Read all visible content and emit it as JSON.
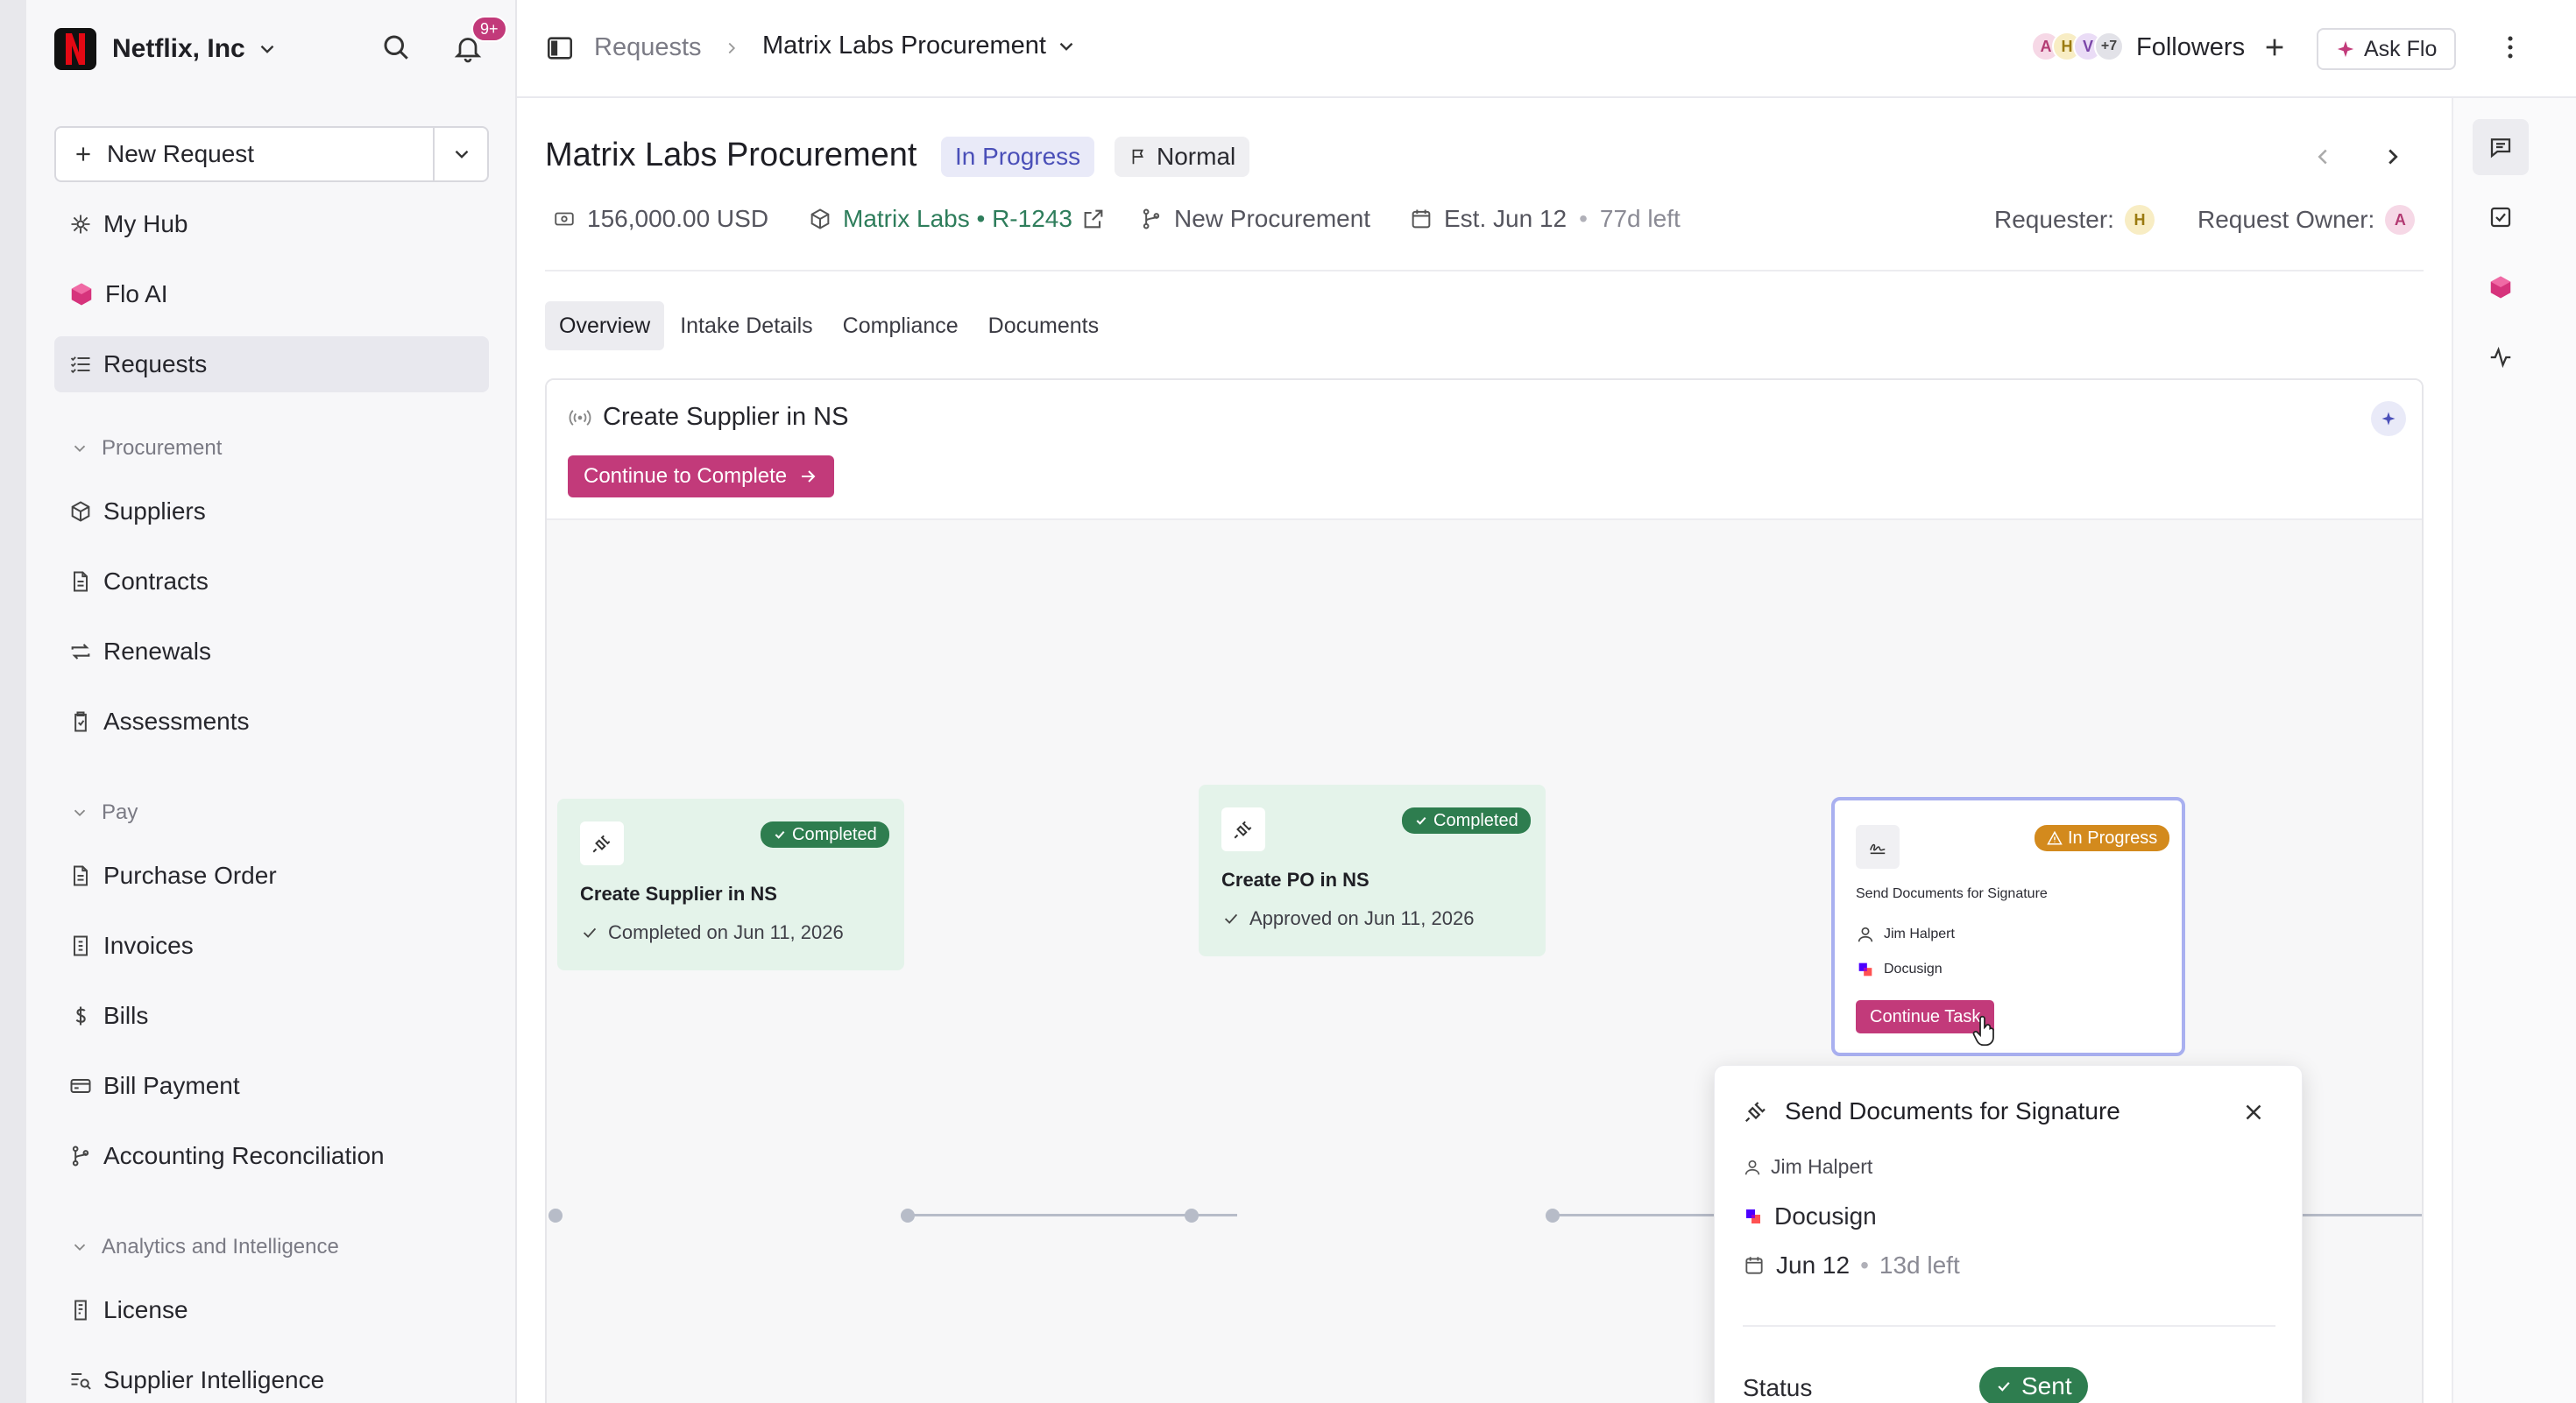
{
  "org": {
    "name": "Netflix, Inc",
    "notification_badge": "9+"
  },
  "sidebar": {
    "new_request": "New Request",
    "items": [
      {
        "label": "My Hub"
      },
      {
        "label": "Flo AI"
      },
      {
        "label": "Requests"
      }
    ],
    "procurement": {
      "label": "Procurement",
      "items": [
        {
          "label": "Suppliers"
        },
        {
          "label": "Contracts"
        },
        {
          "label": "Renewals"
        },
        {
          "label": "Assessments"
        }
      ]
    },
    "pay": {
      "label": "Pay",
      "items": [
        {
          "label": "Purchase Order"
        },
        {
          "label": "Invoices"
        },
        {
          "label": "Bills"
        },
        {
          "label": "Bill Payment"
        },
        {
          "label": "Accounting Reconciliation"
        }
      ]
    },
    "analytics": {
      "label": "Analytics and Intelligence",
      "items": [
        {
          "label": "License"
        },
        {
          "label": "Supplier Intelligence"
        }
      ]
    }
  },
  "topbar": {
    "breadcrumb_root": "Requests",
    "breadcrumb_current": "Matrix Labs Procurement",
    "avatars": [
      "A",
      "H",
      "V",
      "+7"
    ],
    "followers": "Followers",
    "ask_flo": "Ask Flo"
  },
  "request": {
    "title": "Matrix Labs Procurement",
    "status": "In Progress",
    "priority": "Normal",
    "amount": "156,000.00 USD",
    "supplier_link": "Matrix Labs • R-1243",
    "workflow": "New Procurement",
    "estimate": "Est. Jun 12",
    "time_left": "77d left",
    "requester_label": "Requester:",
    "requester_initial": "H",
    "owner_label": "Request Owner:",
    "owner_initial": "A"
  },
  "tabs": [
    {
      "label": "Overview"
    },
    {
      "label": "Intake Details"
    },
    {
      "label": "Compliance"
    },
    {
      "label": "Documents"
    }
  ],
  "panel": {
    "title": "Create Supplier in NS",
    "continue_button": "Continue to Complete"
  },
  "nodes": [
    {
      "title": "Create Supplier in NS",
      "badge": "Completed",
      "detail": "Completed on Jun 11, 2026"
    },
    {
      "title": "Create PO in NS",
      "badge": "Completed",
      "detail": "Approved on Jun 11, 2026"
    },
    {
      "title": "Send Documents for Signature",
      "badge": "In Progress",
      "assignee": "Jim Halpert",
      "app": "Docusign",
      "button": "Continue Task"
    }
  ],
  "popup": {
    "title": "Send Documents for Signature",
    "assignee": "Jim Halpert",
    "app": "Docusign",
    "date": "Jun 12",
    "time_left": "13d left",
    "status_label": "Status",
    "status_value": "Sent"
  },
  "colors": {
    "accent": "#c23a7a",
    "success": "#2e7d4f",
    "warning": "#d38a1d",
    "link": "#2e7d5b",
    "status_pill": "#e9eaf8"
  }
}
